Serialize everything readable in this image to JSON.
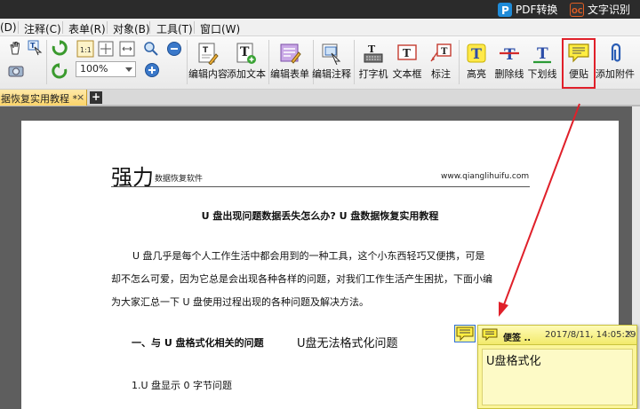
{
  "topbar": {
    "pdf_convert": "PDF转换",
    "ocr": "文字识别",
    "colors": {
      "bg": "#2b2b2b",
      "pdf_icon": "#1f8bd8",
      "ocr_icon": "#e05c22"
    }
  },
  "menu": {
    "items": [
      "(D)",
      "注释(C)",
      "表单(R)",
      "对象(B)",
      "工具(T)",
      "窗口(W)"
    ]
  },
  "toolbar": {
    "zoom": "100%",
    "buttons": [
      {
        "label": "编辑内容",
        "icon": "edit-content-icon"
      },
      {
        "label": "添加文本",
        "icon": "add-text-icon"
      },
      {
        "label": "编辑表单",
        "icon": "edit-form-icon"
      },
      {
        "label": "编辑注释",
        "icon": "edit-annotation-icon"
      },
      {
        "label": "打字机",
        "icon": "typewriter-icon"
      },
      {
        "label": "文本框",
        "icon": "textbox-icon"
      },
      {
        "label": "标注",
        "icon": "callout-icon"
      },
      {
        "label": "高亮",
        "icon": "highlight-icon"
      },
      {
        "label": "删除线",
        "icon": "strikethrough-icon"
      },
      {
        "label": "下划线",
        "icon": "underline-icon"
      },
      {
        "label": "便贴",
        "icon": "sticky-note-icon"
      },
      {
        "label": "添加附件",
        "icon": "attach-icon"
      }
    ]
  },
  "tab": {
    "title": "据恢复实用教程 *",
    "close": "×",
    "add": "+"
  },
  "document": {
    "brand": "强力",
    "brand_sub": "数据恢复软件",
    "url": "www.qianglihuifu.com",
    "title": "U 盘出现问题数据丢失怎么办? U 盘数据恢复实用教程",
    "para_line1": "U 盘几乎是每个人工作生活中都会用到的一种工具，这个小东西轻巧又便携，可是",
    "para_line2": "却不怎么可爱，因为它总是会出现各种各样的问题，对我们工作生活产生困扰，下面小编",
    "para_line3": "为大家汇总一下 U 盘使用过程出现的各种问题及解决方法。",
    "section_heading": "一、与 U 盘格式化相关的问题",
    "section_right": "U盘无法格式化问题",
    "sub_heading": "1.U 盘显示 0 字节问题"
  },
  "note": {
    "author": "便签 ..",
    "date": "2017/8/11, 14:05:29",
    "close": "×",
    "body": "U盘格式化",
    "colors": {
      "bg": "#fbf59a",
      "border": "#c9c23e"
    }
  },
  "highlight": {
    "color": "#e0202a"
  }
}
